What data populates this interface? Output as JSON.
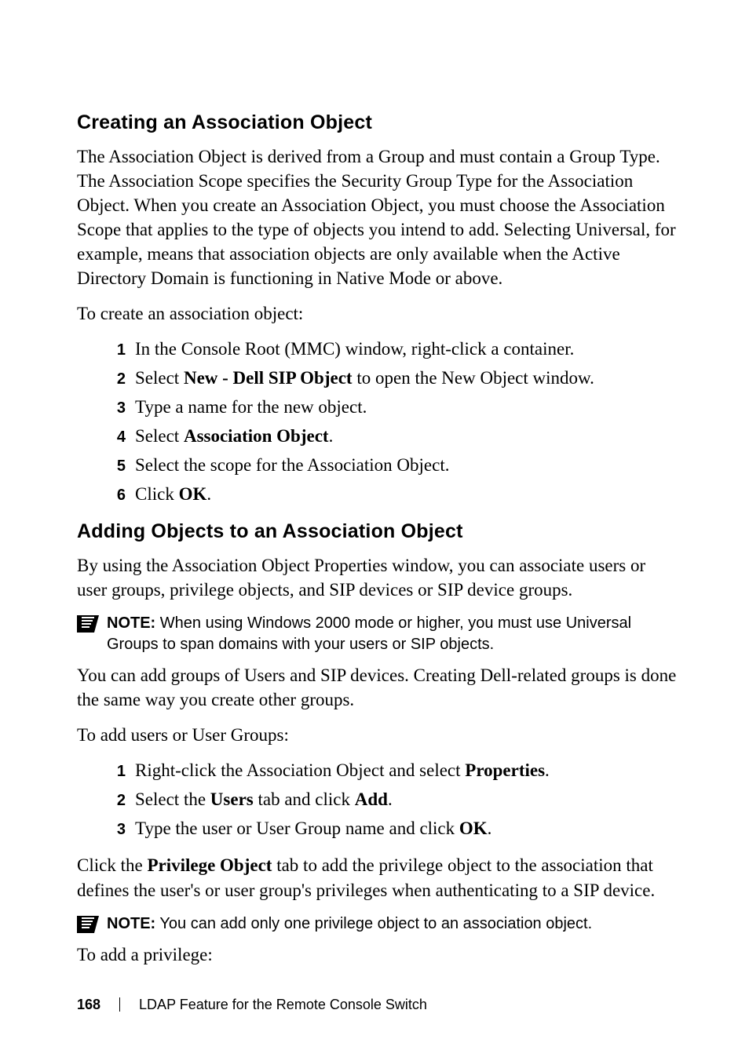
{
  "section1": {
    "heading": "Creating an Association Object",
    "para1": "The Association Object is derived from a Group and must contain a Group Type. The Association Scope specifies the Security Group Type for the Association Object. When you create an Association Object, you must choose the Association Scope that applies to the type of objects you intend to add. Selecting Universal, for example, means that association objects are only available when the Active Directory Domain is functioning in Native Mode or above.",
    "para2": "To create an association object:",
    "steps": {
      "n1": "1",
      "s1_a": "In the Console Root (MMC) window, right-click a container.",
      "n2": "2",
      "s2_a": "Select ",
      "s2_b": "New - Dell SIP Object",
      "s2_c": " to open the New Object window.",
      "n3": "3",
      "s3_a": "Type a name for the new object.",
      "n4": "4",
      "s4_a": "Select ",
      "s4_b": "Association Object",
      "s4_c": ".",
      "n5": "5",
      "s5_a": "Select the scope for the Association Object.",
      "n6": "6",
      "s6_a": "Click ",
      "s6_b": "OK",
      "s6_c": "."
    }
  },
  "section2": {
    "heading": "Adding Objects to an Association Object",
    "para1": "By using the Association Object Properties window, you can associate users or user groups, privilege objects, and SIP devices or SIP device groups.",
    "note1_label": "NOTE:",
    "note1_text": " When using Windows 2000 mode or higher, you must use Universal Groups to span domains with your users or SIP objects.",
    "para2": "You can add groups of Users and SIP devices. Creating Dell-related groups is done the same way you create other groups.",
    "para3": "To add users or User Groups:",
    "steps": {
      "n1": "1",
      "s1_a": "Right-click the Association Object and select ",
      "s1_b": "Properties",
      "s1_c": ".",
      "n2": "2",
      "s2_a": "Select the ",
      "s2_b": "Users",
      "s2_c": " tab and click ",
      "s2_d": "Add",
      "s2_e": ".",
      "n3": "3",
      "s3_a": "Type the user or User Group name and click ",
      "s3_b": "OK",
      "s3_c": "."
    },
    "para4_a": "Click the ",
    "para4_b": "Privilege Object",
    "para4_c": " tab to add the privilege object to the association that defines the user's or user group's privileges when authenticating to a SIP device.",
    "note2_label": "NOTE:",
    "note2_text": " You can add only one privilege object to an association object.",
    "para5": "To add a privilege:"
  },
  "footer": {
    "page": "168",
    "title": "LDAP Feature for the Remote Console Switch"
  }
}
